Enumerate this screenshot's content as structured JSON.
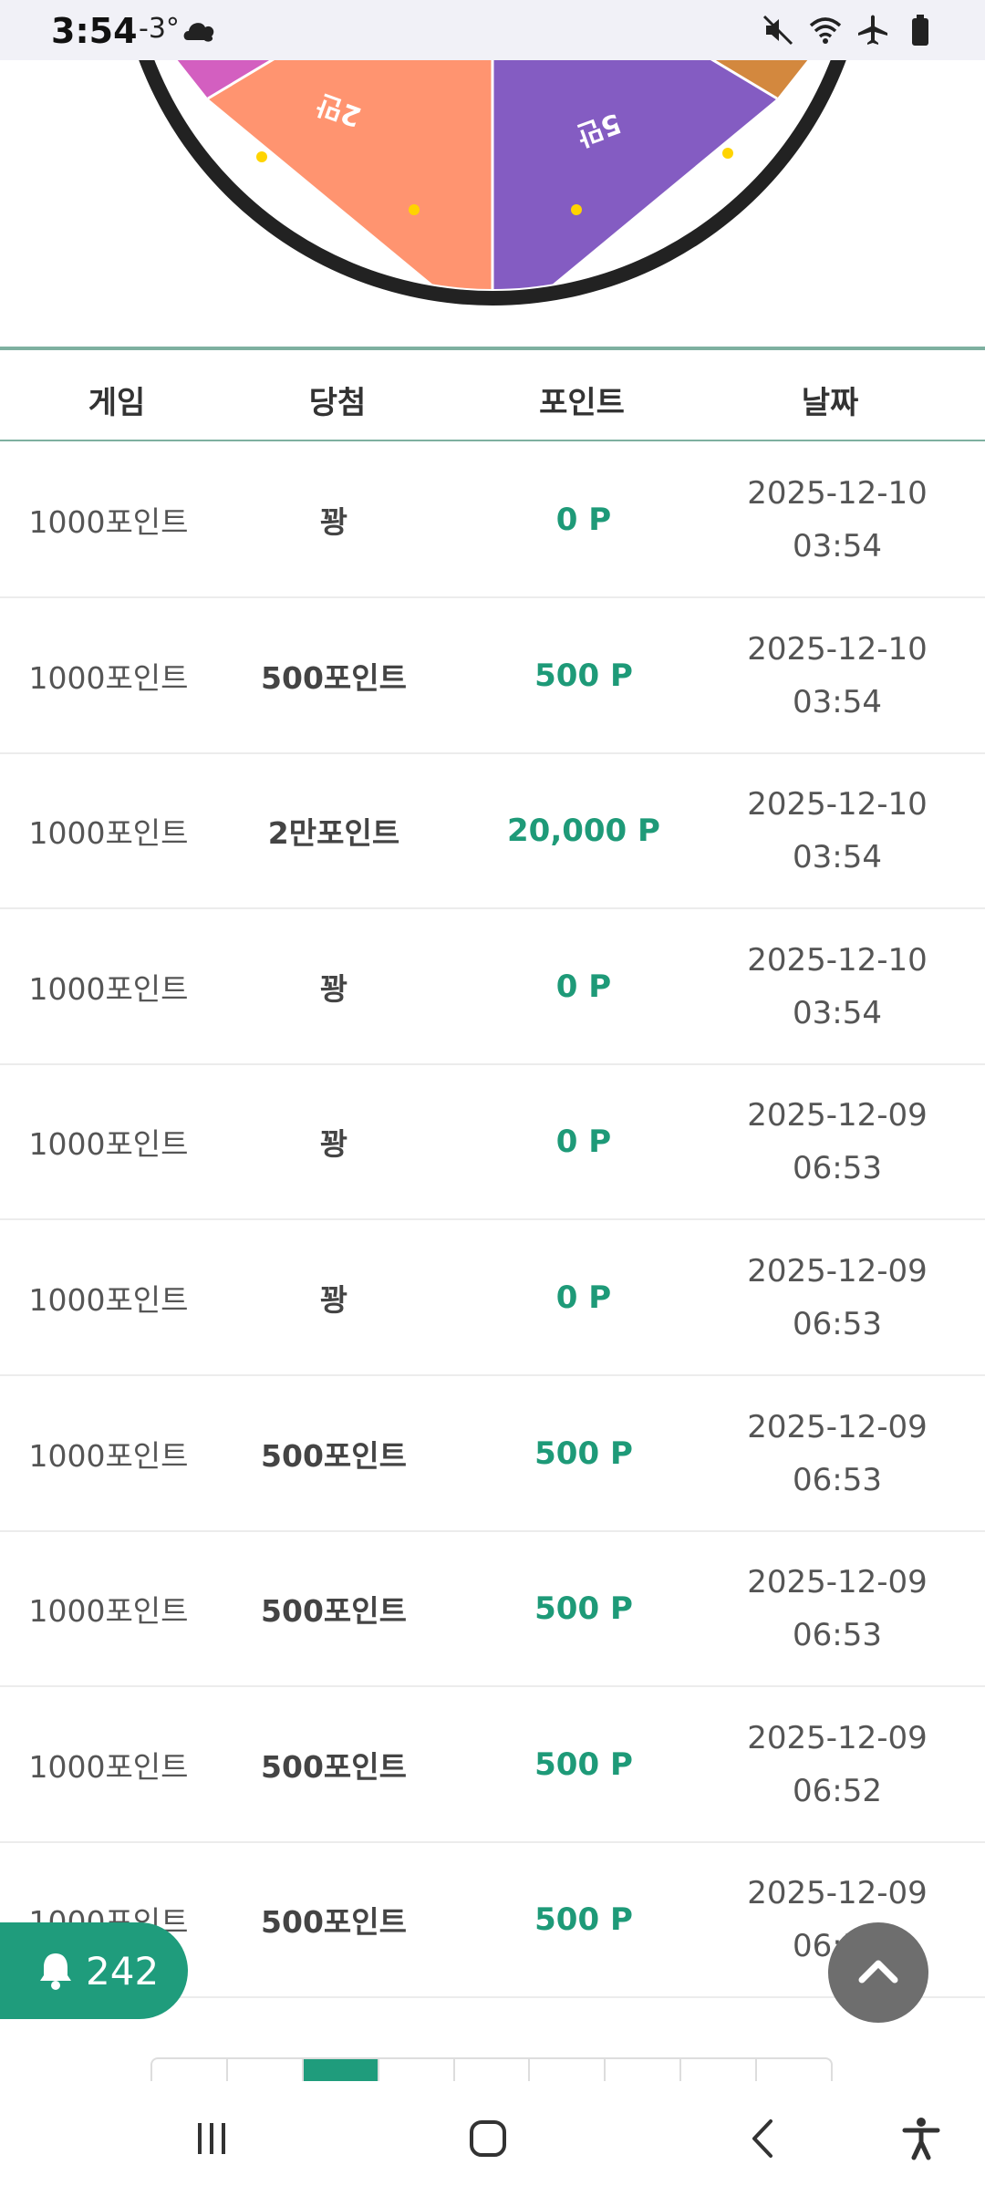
{
  "status_bar": {
    "time": "3:54",
    "temperature": "-3°",
    "left_icon": "cloud-icon",
    "right_icons": [
      "mute-icon",
      "wifi-icon",
      "airplane-icon",
      "battery-icon"
    ]
  },
  "table": {
    "headers": {
      "game": "게임",
      "prize": "당첨",
      "points": "포인트",
      "date": "날짜"
    },
    "rows": [
      {
        "game": "1000포인트",
        "prize": "꽝",
        "points": "0 P",
        "date": "2025-12-10",
        "time": "03:54"
      },
      {
        "game": "1000포인트",
        "prize": "500포인트",
        "points": "500 P",
        "date": "2025-12-10",
        "time": "03:54"
      },
      {
        "game": "1000포인트",
        "prize": "2만포인트",
        "points": "20,000 P",
        "date": "2025-12-10",
        "time": "03:54"
      },
      {
        "game": "1000포인트",
        "prize": "꽝",
        "points": "0 P",
        "date": "2025-12-10",
        "time": "03:54"
      },
      {
        "game": "1000포인트",
        "prize": "꽝",
        "points": "0 P",
        "date": "2025-12-09",
        "time": "06:53"
      },
      {
        "game": "1000포인트",
        "prize": "꽝",
        "points": "0 P",
        "date": "2025-12-09",
        "time": "06:53"
      },
      {
        "game": "1000포인트",
        "prize": "500포인트",
        "points": "500 P",
        "date": "2025-12-09",
        "time": "06:53"
      },
      {
        "game": "1000포인트",
        "prize": "500포인트",
        "points": "500 P",
        "date": "2025-12-09",
        "time": "06:53"
      },
      {
        "game": "1000포인트",
        "prize": "500포인트",
        "points": "500 P",
        "date": "2025-12-09",
        "time": "06:52"
      },
      {
        "game": "1000포인트",
        "prize": "500포인트",
        "points": "500 P",
        "date": "2025-12-09",
        "time": "06:52"
      }
    ]
  },
  "notification": {
    "icon": "bell-icon",
    "count": "242"
  },
  "scroll_top": {
    "icon": "chevron-up-icon"
  },
  "pagination": {
    "active_index": 2,
    "count": 9
  },
  "nav_bar": {
    "icons": [
      "recent-apps-icon",
      "home-icon",
      "back-icon",
      "accessibility-icon"
    ]
  },
  "colors": {
    "accent": "#1f9c7c",
    "point_text": "#1e9a78",
    "header_border": "#7eb0a0",
    "wheel_orange": "#ff9470",
    "wheel_purple": "#845cc2",
    "wheel_pink": "#d35fc0",
    "wheel_brown": "#d3883e"
  }
}
